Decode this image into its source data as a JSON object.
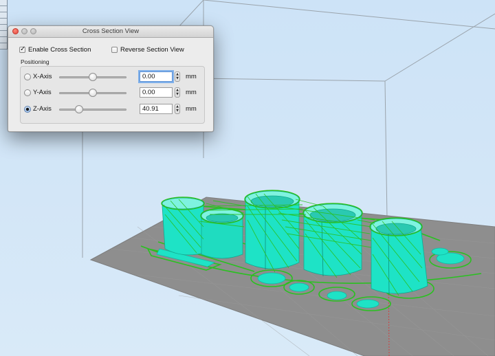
{
  "window": {
    "title": "Cross Section View"
  },
  "options": {
    "enable_cross_section": {
      "label": "Enable Cross Section",
      "checked": true
    },
    "reverse_section_view": {
      "label": "Reverse Section View",
      "checked": false
    }
  },
  "positioning": {
    "label": "Positioning",
    "unit": "mm",
    "axes": [
      {
        "label": "X-Axis",
        "value": "0.00",
        "selected": false,
        "slider_fraction": 0.5
      },
      {
        "label": "Y-Axis",
        "value": "0.00",
        "selected": false,
        "slider_fraction": 0.5
      },
      {
        "label": "Z-Axis",
        "value": "40.91",
        "selected": true,
        "slider_fraction": 0.3
      }
    ]
  },
  "scene": {
    "background_color": "#cfe3f7",
    "bed_color": "#8e8e8e",
    "model_color": "#1ee3c6",
    "toolpath_color": "#29c11f",
    "bounding_box_color": "#9a9a9a"
  }
}
